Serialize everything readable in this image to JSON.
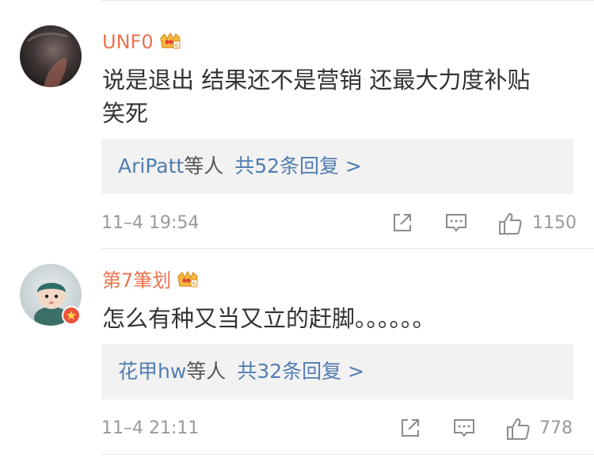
{
  "comments": [
    {
      "user": "UNF0",
      "text_line1": "说是退出 结果还不是营销 还最大力度补贴",
      "text_line2": "笑死",
      "reply_who": "AriPatt",
      "reply_etc": "等人",
      "reply_count": "共52条回复 >",
      "time": "11–4 19:54",
      "likes": "1150",
      "avatar_icon": "dark-photo-avatar"
    },
    {
      "user": "第7筆划",
      "text_line1": "怎么有种又当又立的赶脚。。。。。。",
      "reply_who": "花甲hw",
      "reply_etc": "等人",
      "reply_count": "共32条回复 >",
      "time": "11–4 21:11",
      "likes": "778",
      "avatar_icon": "figurine-avatar"
    }
  ],
  "colors": {
    "username": "#eb7350",
    "link": "#507daf",
    "meta": "#999999",
    "text": "#333333",
    "reply_bg": "#f2f2f2"
  }
}
